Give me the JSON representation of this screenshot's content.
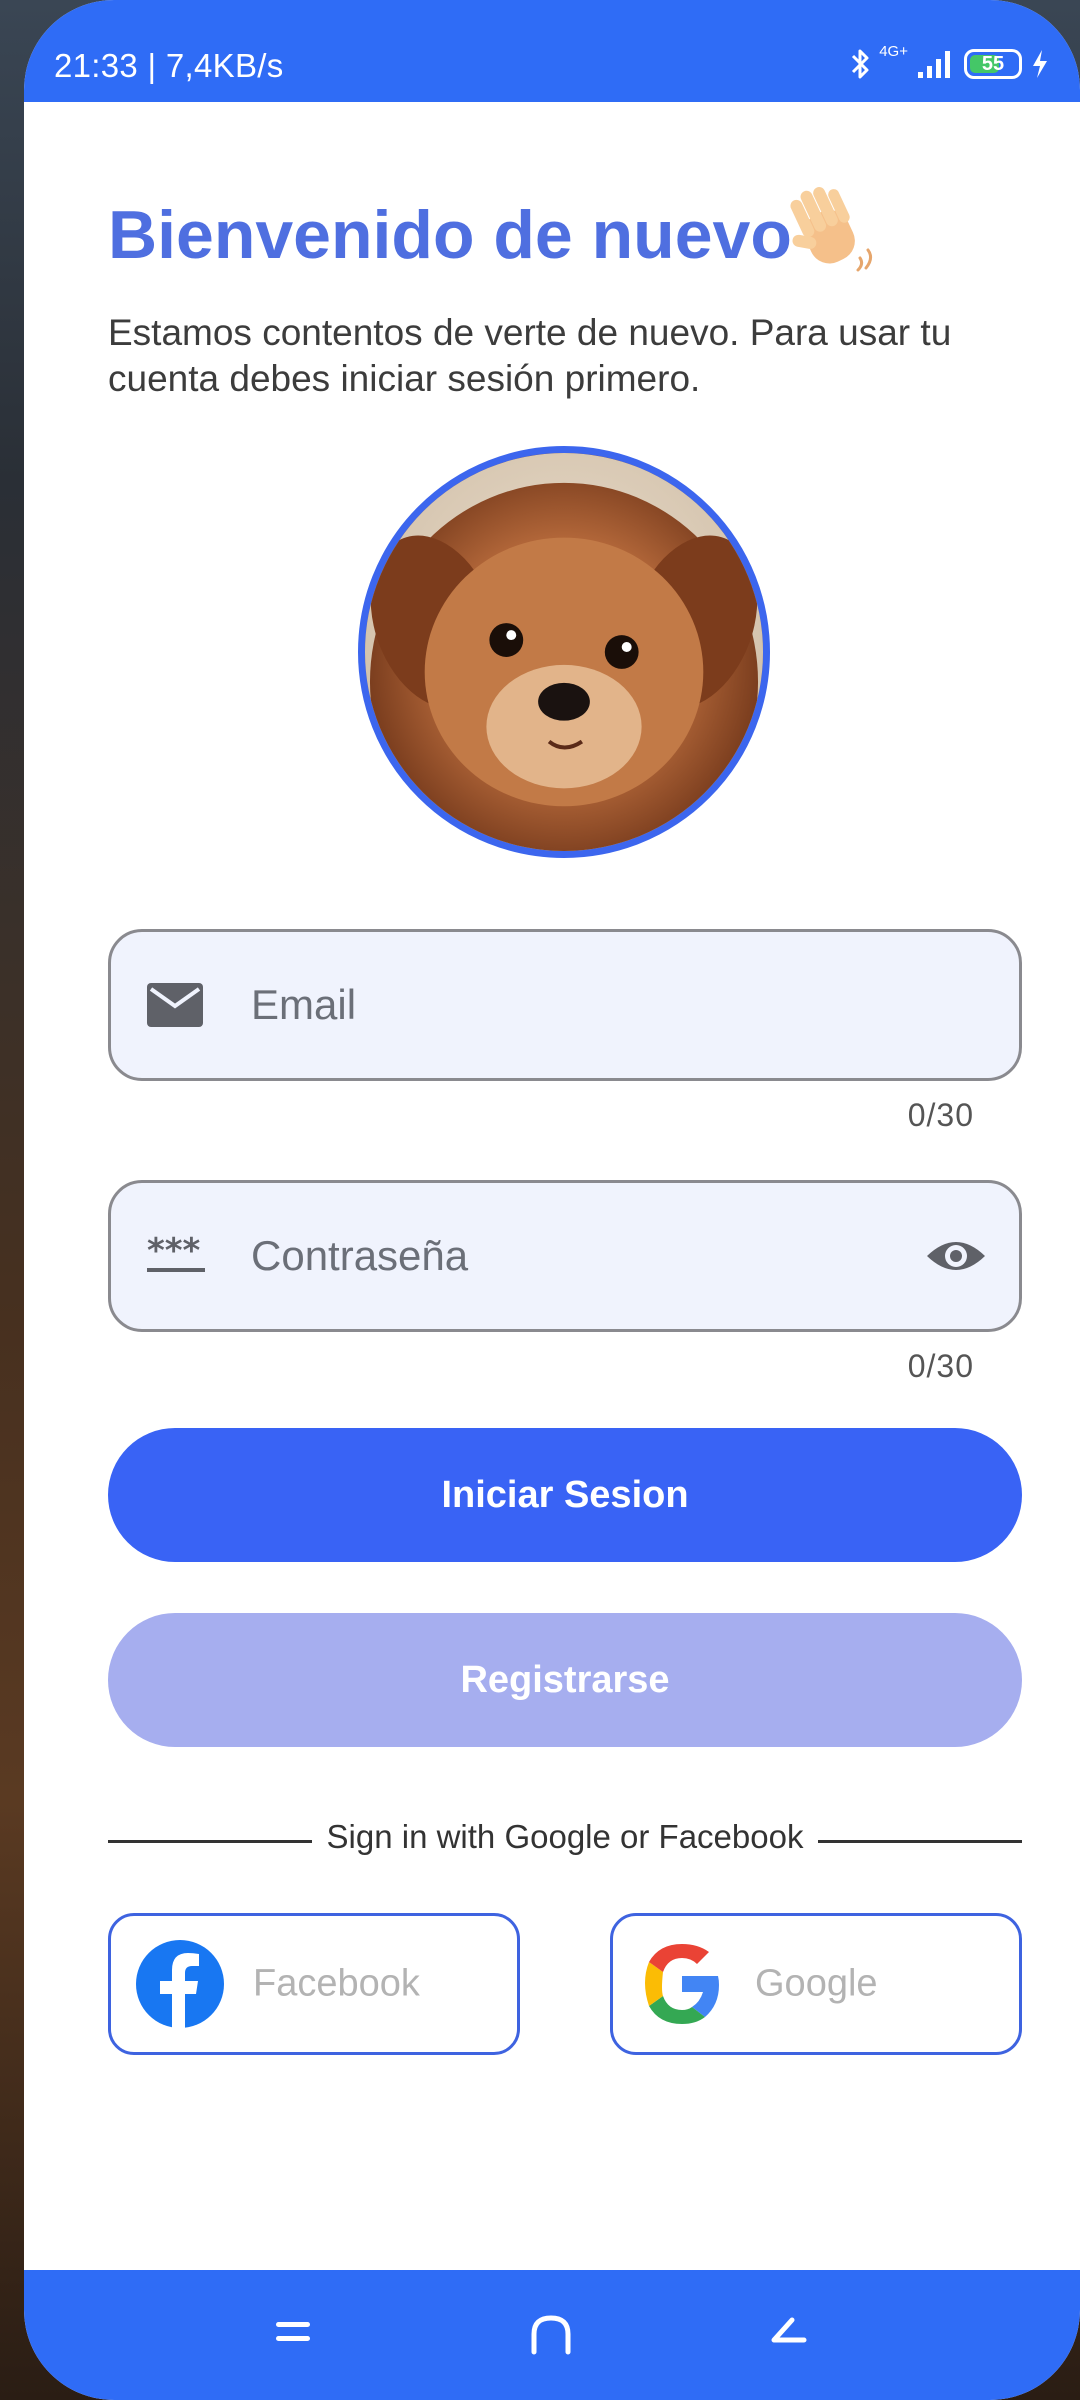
{
  "status_bar": {
    "time_speed": "21:33 | 7,4KB/s",
    "network": "4G+",
    "battery": "55",
    "battery_level": 0.55
  },
  "header": {
    "title": "Bienvenido de nuevo",
    "subtitle": "Estamos contentos de verte de nuevo. Para usar tu cuenta debes iniciar sesión primero."
  },
  "form": {
    "email": {
      "placeholder": "Email",
      "value": "",
      "counter": "0/30"
    },
    "password": {
      "placeholder": "Contraseña",
      "value": "",
      "counter": "0/30",
      "icon_text": "***"
    }
  },
  "buttons": {
    "login_label": "Iniciar Sesion",
    "register_label": "Registrarse"
  },
  "social": {
    "divider_text": "Sign in with Google or Facebook",
    "facebook_label": "Facebook",
    "google_label": "Google"
  },
  "colors": {
    "accent": "#3963f5",
    "title": "#4f6fe0",
    "register_disabled": "#a6aeef",
    "status_bar": "#2f6cf6",
    "facebook": "#1877f2"
  },
  "icons": {
    "email": "mail-icon",
    "password": "password-dots-icon",
    "visibility": "eye-icon",
    "wave": "waving-hand-icon",
    "facebook": "facebook-icon",
    "google": "google-icon"
  }
}
